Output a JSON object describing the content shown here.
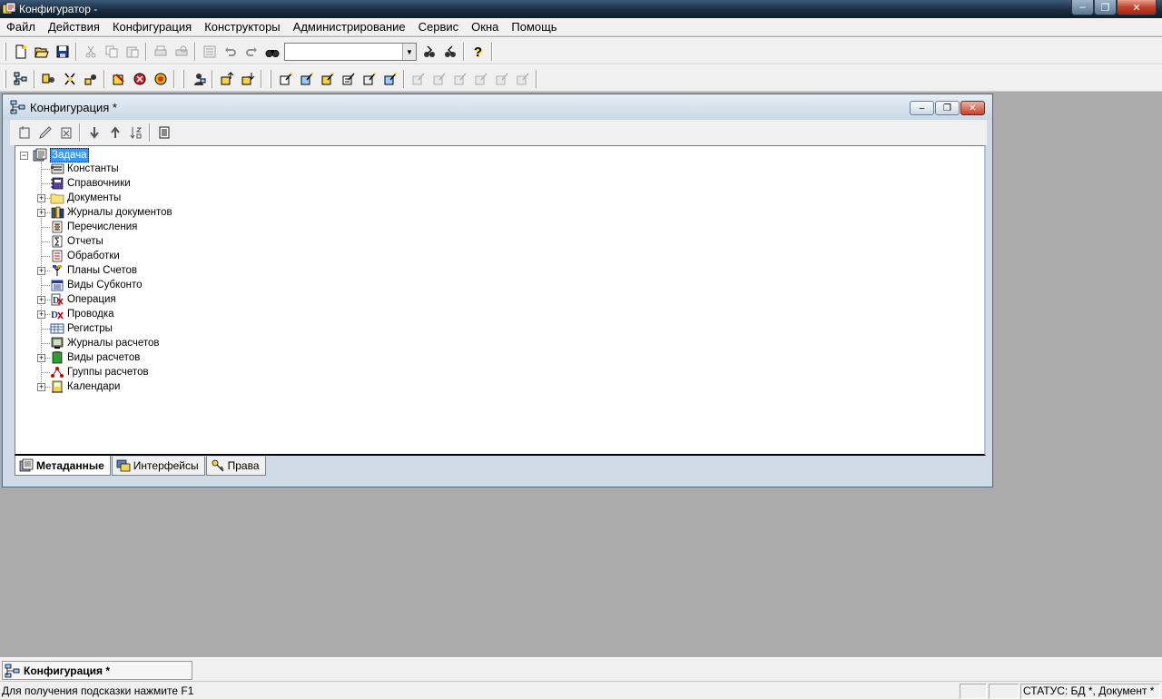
{
  "window": {
    "title": "Конфигуратор -",
    "min_glyph": "‒",
    "max_glyph": "❐",
    "close_glyph": "✕"
  },
  "menu": [
    {
      "label": "Файл"
    },
    {
      "label": "Действия"
    },
    {
      "label": "Конфигурация"
    },
    {
      "label": "Конструкторы"
    },
    {
      "label": "Администрирование"
    },
    {
      "label": "Сервис"
    },
    {
      "label": "Окна"
    },
    {
      "label": "Помощь"
    }
  ],
  "toolbar": {
    "search_value": "",
    "help_glyph": "?",
    "icons1": [
      "new-file-icon",
      "open-folder-icon",
      "save-icon",
      "cut-icon",
      "copy-icon",
      "paste-icon",
      "print-icon",
      "print-preview-icon",
      "properties-icon",
      "undo-icon",
      "redo-icon",
      "find-icon",
      "find-next-icon",
      "find-prev-icon",
      "help-icon"
    ],
    "icons2": [
      "config-window-icon",
      "open-config-icon",
      "save-config-icon",
      "load-config-icon",
      "merge-config-icon",
      "debug-stop-icon",
      "debug-run-icon",
      "users-icon",
      "upload-icon",
      "download-icon",
      "designer1-icon",
      "designer2-icon",
      "designer3-icon",
      "designer4-icon",
      "designer5-icon",
      "designer6-icon"
    ]
  },
  "config_window": {
    "title": "Конфигурация *",
    "tree_root": "Задача",
    "tree": [
      {
        "label": "Константы",
        "expandable": false,
        "icon": "constants-icon"
      },
      {
        "label": "Справочники",
        "expandable": false,
        "icon": "catalogs-icon"
      },
      {
        "label": "Документы",
        "expandable": true,
        "icon": "folder-icon"
      },
      {
        "label": "Журналы документов",
        "expandable": true,
        "icon": "journals-icon"
      },
      {
        "label": "Перечисления",
        "expandable": false,
        "icon": "enums-icon"
      },
      {
        "label": "Отчеты",
        "expandable": false,
        "icon": "reports-icon"
      },
      {
        "label": "Обработки",
        "expandable": false,
        "icon": "processing-icon"
      },
      {
        "label": "Планы Счетов",
        "expandable": true,
        "icon": "chart-of-accounts-icon"
      },
      {
        "label": "Виды Субконто",
        "expandable": false,
        "icon": "subconto-icon"
      },
      {
        "label": "Операция",
        "expandable": true,
        "icon": "operation-icon"
      },
      {
        "label": "Проводка",
        "expandable": true,
        "icon": "posting-icon"
      },
      {
        "label": "Регистры",
        "expandable": false,
        "icon": "registers-icon"
      },
      {
        "label": "Журналы расчетов",
        "expandable": false,
        "icon": "calc-journals-icon"
      },
      {
        "label": "Виды расчетов",
        "expandable": true,
        "icon": "calc-types-icon"
      },
      {
        "label": "Группы расчетов",
        "expandable": false,
        "icon": "calc-groups-icon"
      },
      {
        "label": "Календари",
        "expandable": true,
        "icon": "calendars-icon"
      }
    ],
    "tabs": [
      {
        "label": "Метаданные",
        "active": true
      },
      {
        "label": "Интерфейсы",
        "active": false
      },
      {
        "label": "Права",
        "active": false
      }
    ]
  },
  "mdi_bar": {
    "label": "Конфигурация *"
  },
  "status": {
    "hint": "Для получения подсказки нажмите F1",
    "panel1": "",
    "panel2": "",
    "status_text": "СТАТУС: БД *, Документ *"
  },
  "colors": {
    "desktop": "#ababab",
    "selection": "#3399ff"
  }
}
